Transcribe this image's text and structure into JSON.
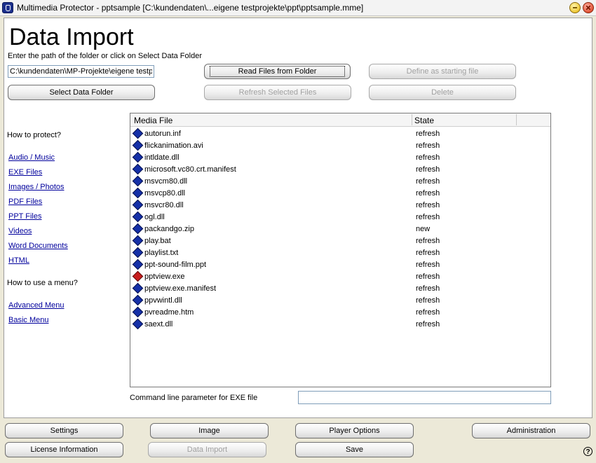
{
  "window": {
    "title": "Multimedia Protector - pptsample [C:\\kundendaten\\...eigene testprojekte\\ppt\\pptsample.mme]"
  },
  "main": {
    "title": "Data Import",
    "instruction": "Enter the path of the folder or click on Select Data Folder",
    "path_value": "C:\\kundendaten\\MP-Projekte\\eigene testprojekte\\ppt",
    "buttons": {
      "read_files": "Read Files from Folder",
      "define_start": "Define as starting file",
      "select_folder": "Select Data Folder",
      "refresh_selected": "Refresh Selected Files",
      "delete": "Delete"
    },
    "list": {
      "columns": [
        "Media File",
        "State"
      ],
      "rows": [
        {
          "name": "autorun.inf",
          "state": "refresh",
          "icon": "blue-diamond-icon"
        },
        {
          "name": "flickanimation.avi",
          "state": "refresh",
          "icon": "blue-diamond-icon"
        },
        {
          "name": "intldate.dll",
          "state": "refresh",
          "icon": "blue-diamond-icon"
        },
        {
          "name": "microsoft.vc80.crt.manifest",
          "state": "refresh",
          "icon": "blue-diamond-icon"
        },
        {
          "name": "msvcm80.dll",
          "state": "refresh",
          "icon": "blue-diamond-icon"
        },
        {
          "name": "msvcp80.dll",
          "state": "refresh",
          "icon": "blue-diamond-icon"
        },
        {
          "name": "msvcr80.dll",
          "state": "refresh",
          "icon": "blue-diamond-icon"
        },
        {
          "name": "ogl.dll",
          "state": "refresh",
          "icon": "blue-diamond-icon"
        },
        {
          "name": "packandgo.zip",
          "state": "new",
          "icon": "blue-diamond-icon"
        },
        {
          "name": "play.bat",
          "state": "refresh",
          "icon": "blue-diamond-icon"
        },
        {
          "name": "playlist.txt",
          "state": "refresh",
          "icon": "blue-diamond-icon"
        },
        {
          "name": "ppt-sound-film.ppt",
          "state": "refresh",
          "icon": "blue-diamond-icon"
        },
        {
          "name": "pptview.exe",
          "state": "refresh",
          "icon": "red-diamond-icon"
        },
        {
          "name": "pptview.exe.manifest",
          "state": "refresh",
          "icon": "blue-diamond-icon"
        },
        {
          "name": "ppvwintl.dll",
          "state": "refresh",
          "icon": "blue-diamond-icon"
        },
        {
          "name": "pvreadme.htm",
          "state": "refresh",
          "icon": "blue-diamond-icon"
        },
        {
          "name": "saext.dll",
          "state": "refresh",
          "icon": "blue-diamond-icon"
        }
      ]
    },
    "command_label": "Command line parameter for EXE file",
    "command_value": ""
  },
  "sidebar": {
    "protect_heading": "How to protect?",
    "protect_links": [
      "Audio / Music",
      "EXE Files",
      "Images / Photos",
      "PDF Files",
      "PPT Files",
      "Videos",
      "Word Documents",
      "HTML"
    ],
    "menu_heading": "How to use a menu?",
    "menu_links": [
      "Advanced Menu",
      "Basic Menu"
    ]
  },
  "footer": {
    "settings": "Settings",
    "image": "Image",
    "player_options": "Player Options",
    "administration": "Administration",
    "license_information": "License Information",
    "data_import": "Data Import",
    "save": "Save",
    "help_glyph": "?"
  }
}
